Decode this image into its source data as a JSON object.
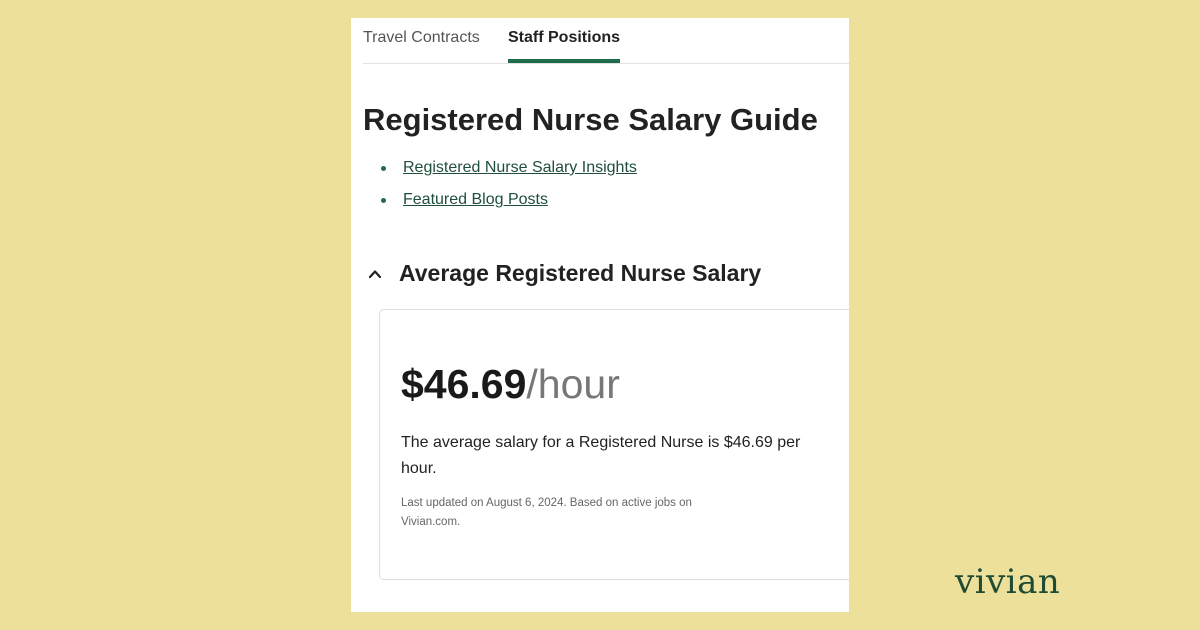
{
  "tabs": [
    {
      "label": "Travel Contracts",
      "active": false
    },
    {
      "label": "Staff Positions",
      "active": true
    }
  ],
  "page_title": "Registered Nurse Salary Guide",
  "links": [
    {
      "label": "Registered Nurse Salary Insights"
    },
    {
      "label": "Featured Blog Posts"
    }
  ],
  "section": {
    "title": "Average Registered Nurse Salary",
    "expanded": true,
    "chevron_icon": "chevron-up-icon"
  },
  "salary_card": {
    "amount": "$46.69",
    "unit": "/hour",
    "description": "The average salary for a Registered Nurse is $46.69 per hour.",
    "note": "Last updated on August 6, 2024. Based on active jobs on Vivian.com."
  },
  "brand": {
    "logo_text": "vivian"
  },
  "colors": {
    "background": "#ede09b",
    "accent": "#1f6b4a",
    "brand": "#1f4a33"
  }
}
